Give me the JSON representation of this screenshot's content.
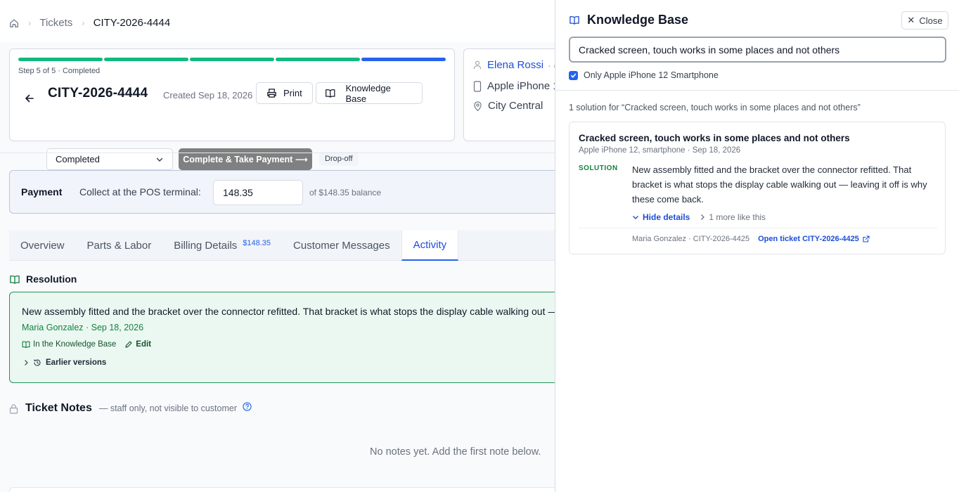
{
  "breadcrumb": {
    "home_icon": "home-icon",
    "items": [
      "Tickets",
      "CITY-2026-4444"
    ]
  },
  "ticket": {
    "step_text": "Step 5 of 5 · Completed",
    "progress": {
      "completed_steps": 4,
      "current_step": 5,
      "total_steps": 5,
      "colors": {
        "done": "#10b981",
        "current": "#2563eb"
      }
    },
    "id": "CITY-2026-4444",
    "created": "Created Sep 18, 2026",
    "print_label": "Print",
    "kb_label": "Knowledge Base",
    "status_value": "Completed",
    "primary_action": "Complete & Take Payment ⟶",
    "dropoff_badge": "Drop-off"
  },
  "customer": {
    "name": "Elena Rossi",
    "name_suffix": "· c",
    "device": "Apple iPhone 1",
    "location": "City Central"
  },
  "payment": {
    "label": "Payment",
    "collect_text": "Collect at the POS terminal:",
    "amount": "148.35",
    "balance_text": "of $148.35 balance"
  },
  "tabs": [
    {
      "label": "Overview",
      "active": false
    },
    {
      "label": "Parts & Labor",
      "active": false
    },
    {
      "label": "Billing Details",
      "badge": "$148.35",
      "active": false
    },
    {
      "label": "Customer Messages",
      "active": false
    },
    {
      "label": "Activity",
      "active": true
    }
  ],
  "resolution": {
    "title": "Resolution",
    "text": "New assembly fitted and the bracket over the connector refitted. That bracket is what stops the display cable walking out — leaving it off is why these come back.",
    "meta": "Maria Gonzalez · Sep 18, 2026",
    "kb_link": "In the Knowledge Base",
    "edit_label": "Edit",
    "earlier_label": "Earlier versions",
    "accent_color": "#23935b"
  },
  "notes": {
    "title": "Ticket Notes",
    "subtitle": "— staff only, not visible to customer",
    "empty_text": "No notes yet. Add the first note below."
  },
  "drawer": {
    "title": "Knowledge Base",
    "close_label": "Close",
    "search_value": "Cracked screen, touch works in some places and not others",
    "filter_label": "Only Apple iPhone 12 Smartphone",
    "filter_checked": true,
    "results_text": "1 solution for “Cracked screen, touch works in some places and not others”",
    "solution": {
      "title": "Cracked screen, touch works in some places and not others",
      "subtitle": "Apple iPhone 12, smartphone · Sep 18, 2026",
      "label": "SOLUTION",
      "text": "New assembly fitted and the bracket over the connector refitted. That bracket is what stops the display cable walking out — leaving it off is why these come back.",
      "hide_details": "Hide details",
      "more_like": "1 more like this",
      "footer_meta": "Maria Gonzalez · CITY-2026-4425",
      "open_ticket": "Open ticket CITY-2026-4425"
    }
  }
}
